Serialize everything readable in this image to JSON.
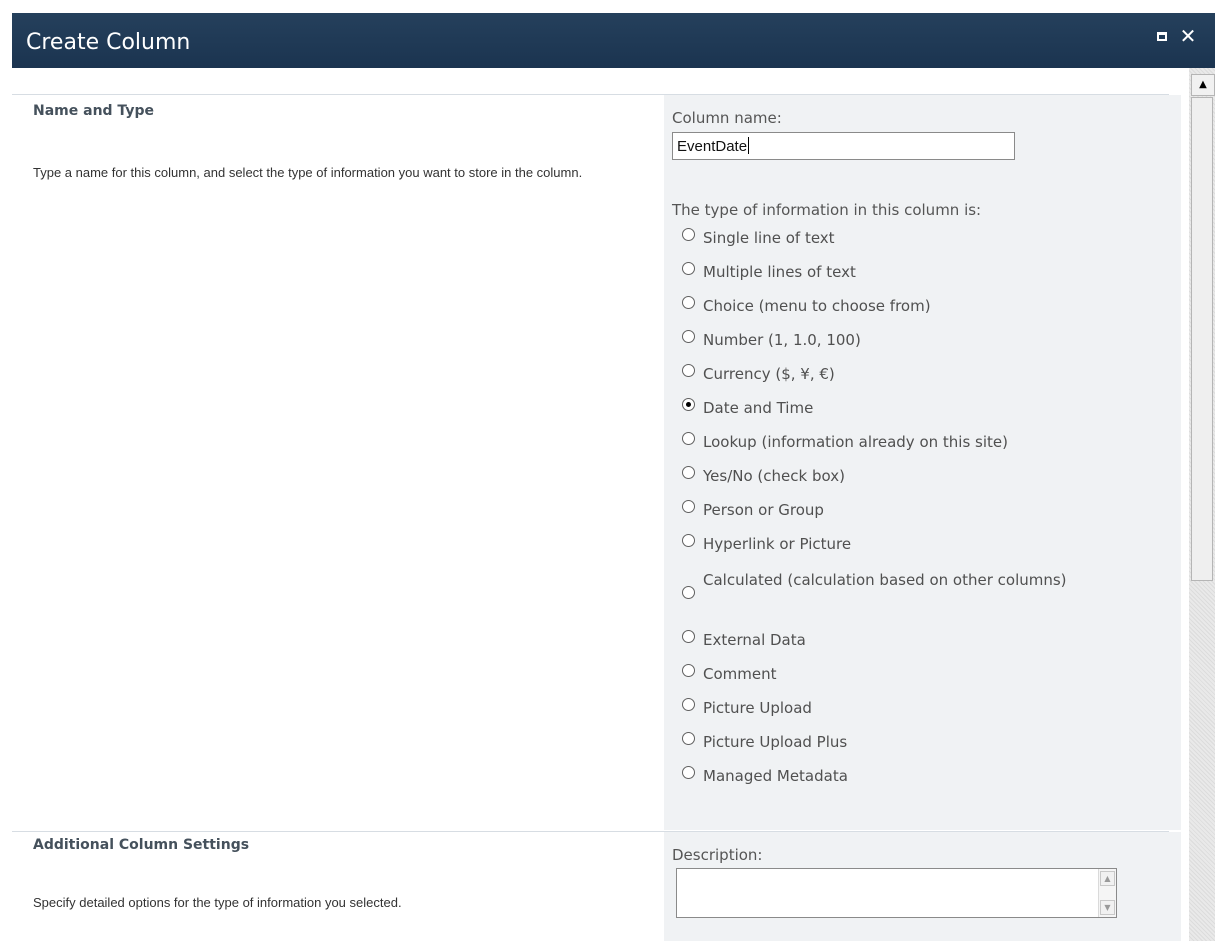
{
  "window": {
    "title": "Create Column",
    "maximize_icon": "maximize-icon",
    "close_icon": "close-icon",
    "close_glyph": "✕"
  },
  "name_and_type": {
    "heading": "Name and Type",
    "description": "Type a name for this column, and select the type of information you want to store in the column.",
    "column_name_label": "Column name:",
    "column_name_value": "EventDate",
    "type_label": "The type of information in this column is:",
    "type_options": [
      {
        "label": "Single line of text",
        "selected": false
      },
      {
        "label": "Multiple lines of text",
        "selected": false
      },
      {
        "label": "Choice (menu to choose from)",
        "selected": false
      },
      {
        "label": "Number (1, 1.0, 100)",
        "selected": false
      },
      {
        "label": "Currency ($, ¥, €)",
        "selected": false
      },
      {
        "label": "Date and Time",
        "selected": true
      },
      {
        "label": "Lookup (information already on this site)",
        "selected": false
      },
      {
        "label": "Yes/No (check box)",
        "selected": false
      },
      {
        "label": "Person or Group",
        "selected": false
      },
      {
        "label": "Hyperlink or Picture",
        "selected": false
      },
      {
        "label": "Calculated (calculation based on other columns)",
        "selected": false
      },
      {
        "label": "External Data",
        "selected": false
      },
      {
        "label": "Comment",
        "selected": false
      },
      {
        "label": "Picture Upload",
        "selected": false
      },
      {
        "label": "Picture Upload Plus",
        "selected": false
      },
      {
        "label": "Managed Metadata",
        "selected": false
      }
    ]
  },
  "additional_settings": {
    "heading": "Additional Column Settings",
    "description": "Specify detailed options for the type of information you selected.",
    "description_field_label": "Description:",
    "description_field_value": ""
  },
  "colors": {
    "titlebar": "#1b3450",
    "panel": "#f0f2f4",
    "heading_text": "#45515c"
  }
}
